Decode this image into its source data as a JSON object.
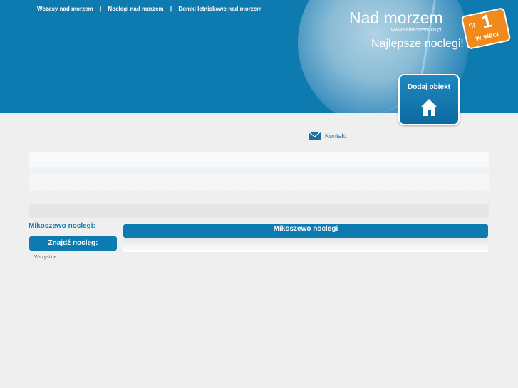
{
  "header": {
    "nav": [
      "Wczasy nad morzem",
      "Noclegi nad morzem",
      "Domki letniskowe nad morzem"
    ],
    "separator": "|",
    "title": "Nad morzem",
    "url": "www.nadmorzem.co.pl",
    "tagline": "Najlepsze noclegi!",
    "badge": {
      "nr": "nr",
      "one": "1",
      "w_sieci": "w sieci"
    },
    "add_button": "Dodaj obiekt"
  },
  "contact": {
    "label": "Kontakt",
    "icon": "envelope-icon"
  },
  "sidebar": {
    "title": "Mikoszewo noclegi:",
    "find_button": "Znajdź nocleg:",
    "all_link": "Wszystkie"
  },
  "main": {
    "heading": "Mikoszewo noclegi"
  },
  "colors": {
    "brand": "#0e7bb0",
    "badge": "#f08a1c",
    "background": "#efefef"
  }
}
